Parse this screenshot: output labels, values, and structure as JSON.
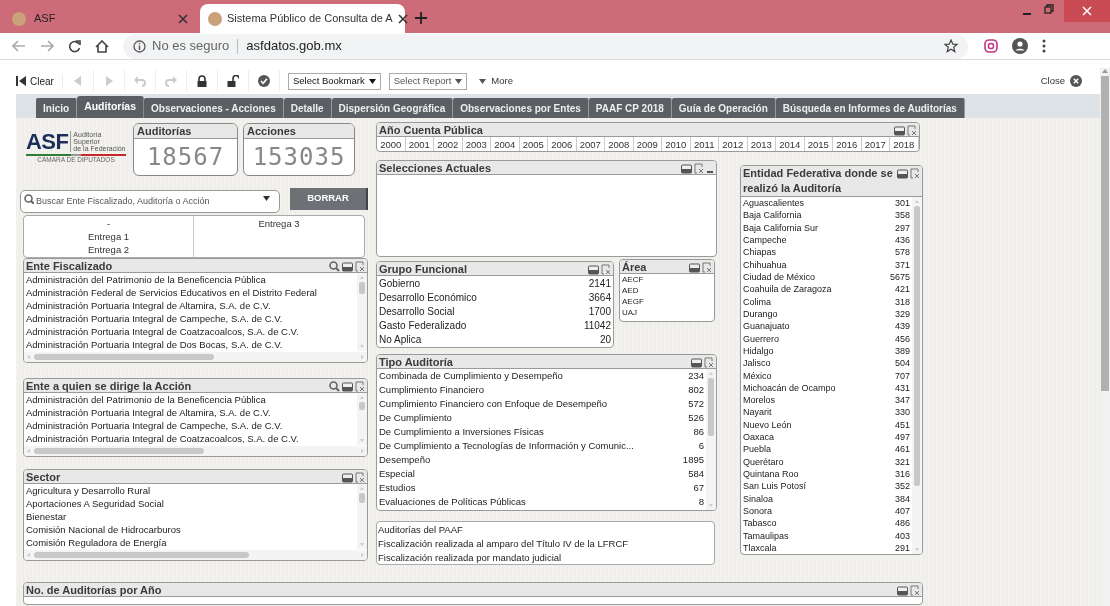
{
  "browser": {
    "tabs": [
      {
        "title": "ASF",
        "selected": false
      },
      {
        "title": "Sistema Público de Consulta de A",
        "selected": true
      }
    ],
    "security": "No es seguro",
    "url": "asfdatos.gob.mx"
  },
  "toolbar": {
    "clear": "Clear",
    "bookmark": "Select Bookmark",
    "report": "Select Report",
    "more": "More",
    "close": "Close"
  },
  "sheet_tabs": [
    {
      "label": "Inicio",
      "selected": false
    },
    {
      "label": "Auditorías",
      "selected": true
    },
    {
      "label": "Observaciones - Acciones",
      "selected": false
    },
    {
      "label": "Detalle",
      "selected": false
    },
    {
      "label": "Dispersión Geográfica",
      "selected": false
    },
    {
      "label": "Observaciones por Entes",
      "selected": false
    },
    {
      "label": "PAAF CP 2018",
      "selected": false
    },
    {
      "label": "Guía de Operación",
      "selected": false
    },
    {
      "label": "Búsqueda en Informes de Auditorías",
      "selected": false
    }
  ],
  "logo": {
    "text": "ASF",
    "subtitle_lines": [
      "Auditoría",
      "Superior",
      "de la Federación"
    ],
    "footer": "CÁMARA DE DIPUTADOS"
  },
  "counters": [
    {
      "label": "Auditorías",
      "value": "18567"
    },
    {
      "label": "Acciones",
      "value": "153035"
    }
  ],
  "search": {
    "placeholder": "Buscar Ente Fiscalizado, Auditoría o Acción"
  },
  "clear_button": "BORRAR",
  "entregas": {
    "column_1": [
      "-",
      "Entrega 1",
      "Entrega 2"
    ],
    "column_2": [
      "Entrega 3"
    ]
  },
  "ente_fiscalizado": {
    "title": "Ente Fiscalizado",
    "searchable": true,
    "items": [
      "Administración del Patrimonio de la Beneficencia Pública",
      "Administración Federal de Servicios Educativos en el Distrito Federal",
      "Administración Portuaria Integral de Altamira, S.A. de C.V.",
      "Administración Portuaria Integral de Campeche, S.A. de C.V.",
      "Administración Portuaria Integral de Coatzacoalcos, S.A. de C.V.",
      "Administración Portuaria Integral de Dos Bocas, S.A. de C.V."
    ]
  },
  "ente_accion": {
    "title": "Ente a quien se dirige la Acción",
    "searchable": true,
    "items": [
      "Administración del Patrimonio de la Beneficencia Pública",
      "Administración Portuaria Integral de Altamira, S.A. de C.V.",
      "Administración Portuaria Integral de Campeche, S.A. de C.V.",
      "Administración Portuaria Integral de Coatzacoalcos, S.A. de C.V."
    ]
  },
  "sector": {
    "title": "Sector",
    "searchable": false,
    "items": [
      "Agricultura y Desarrollo Rural",
      "Aportaciones A Seguridad Social",
      "Bienestar",
      "Comisión Nacional de Hidrocarburos",
      "Comisión Reguladora de Energía"
    ]
  },
  "year_panel": {
    "title": "Año Cuenta Pública",
    "years": [
      "2000",
      "2001",
      "2002",
      "2003",
      "2004",
      "2005",
      "2006",
      "2007",
      "2008",
      "2009",
      "2010",
      "2011",
      "2012",
      "2013",
      "2014",
      "2015",
      "2016",
      "2017",
      "2018"
    ]
  },
  "selections": {
    "title": "Selecciones Actuales",
    "minimizable": true
  },
  "grupo_funcional": {
    "title": "Grupo Funcional",
    "items": [
      {
        "label": "Gobierno",
        "count": "2141"
      },
      {
        "label": "Desarrollo Económico",
        "count": "3664"
      },
      {
        "label": "Desarrollo Social",
        "count": "1700"
      },
      {
        "label": "Gasto Federalizado",
        "count": "11042"
      },
      {
        "label": "No Aplica",
        "count": "20"
      }
    ]
  },
  "area": {
    "title": "Área",
    "items": [
      "AECF",
      "AED",
      "AEGF",
      "UAJ"
    ]
  },
  "tipo_auditoria": {
    "title": "Tipo Auditoría",
    "items": [
      {
        "label": "Combinada de Cumplimiento y Desempeño",
        "count": "234"
      },
      {
        "label": "Cumplimiento Financiero",
        "count": "802"
      },
      {
        "label": "Cumplimiento Financiero con Enfoque de Desempeño",
        "count": "572"
      },
      {
        "label": "De Cumplimiento",
        "count": "526"
      },
      {
        "label": "De Cumplimiento a Inversiones Físicas",
        "count": "86"
      },
      {
        "label": "De Cumplimiento a Tecnologías de Información y Comunic...",
        "count": "6"
      },
      {
        "label": "Desempeño",
        "count": "1895"
      },
      {
        "label": "Especial",
        "count": "584"
      },
      {
        "label": "Estudios",
        "count": "67"
      },
      {
        "label": "Evaluaciones de Políticas Públicas",
        "count": "8"
      }
    ]
  },
  "paaf_list": {
    "items": [
      "Auditorías del PAAF",
      "Fiscalización realizada al amparo del Título IV de la LFRCF",
      "Fiscalización realizada por mandato judicial"
    ]
  },
  "entidad": {
    "title": "Entidad Federativa donde se realizó la Auditoría",
    "items": [
      {
        "label": "Aguascalientes",
        "count": "301"
      },
      {
        "label": "Baja California",
        "count": "358"
      },
      {
        "label": "Baja California Sur",
        "count": "297"
      },
      {
        "label": "Campeche",
        "count": "436"
      },
      {
        "label": "Chiapas",
        "count": "578"
      },
      {
        "label": "Chihuahua",
        "count": "371"
      },
      {
        "label": "Ciudad de México",
        "count": "5675"
      },
      {
        "label": "Coahuila de Zaragoza",
        "count": "421"
      },
      {
        "label": "Colima",
        "count": "318"
      },
      {
        "label": "Durango",
        "count": "329"
      },
      {
        "label": "Guanajuato",
        "count": "439"
      },
      {
        "label": "Guerrero",
        "count": "456"
      },
      {
        "label": "Hidalgo",
        "count": "389"
      },
      {
        "label": "Jalisco",
        "count": "504"
      },
      {
        "label": "México",
        "count": "707"
      },
      {
        "label": "Michoacán de Ocampo",
        "count": "431"
      },
      {
        "label": "Morelos",
        "count": "347"
      },
      {
        "label": "Nayarit",
        "count": "330"
      },
      {
        "label": "Nuevo León",
        "count": "451"
      },
      {
        "label": "Oaxaca",
        "count": "497"
      },
      {
        "label": "Puebla",
        "count": "461"
      },
      {
        "label": "Querétaro",
        "count": "321"
      },
      {
        "label": "Quintana Roo",
        "count": "316"
      },
      {
        "label": "San Luis Potosí",
        "count": "352"
      },
      {
        "label": "Sinaloa",
        "count": "384"
      },
      {
        "label": "Sonora",
        "count": "407"
      },
      {
        "label": "Tabasco",
        "count": "486"
      },
      {
        "label": "Tamaulipas",
        "count": "403"
      },
      {
        "label": "Tlaxcala",
        "count": "291"
      }
    ]
  },
  "chart_panel": {
    "title": "No. de Auditorías por Año"
  }
}
